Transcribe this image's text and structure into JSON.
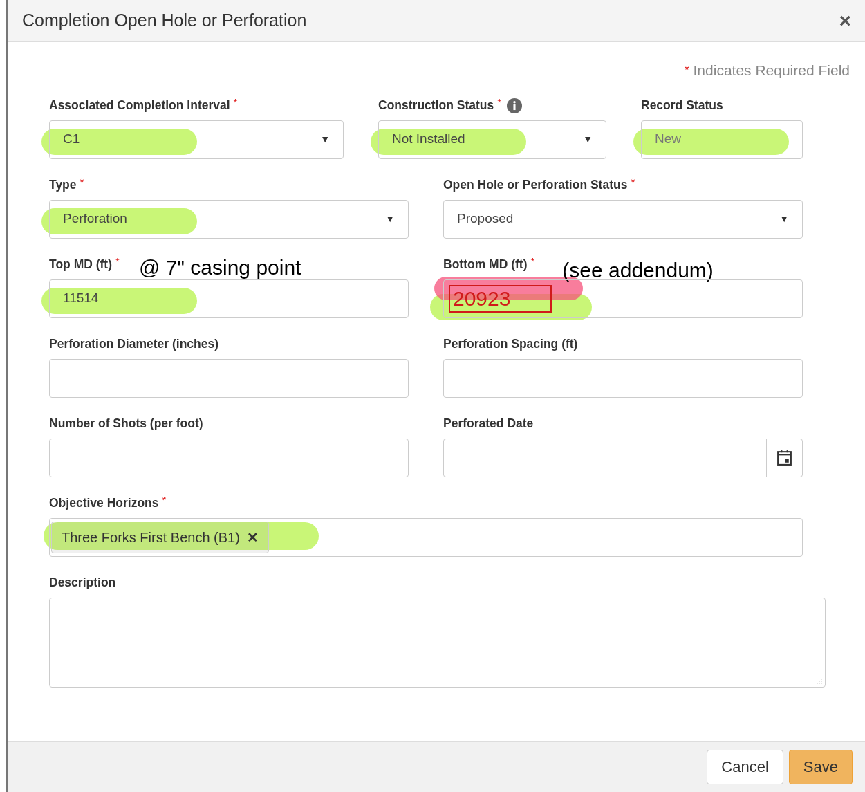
{
  "dialog": {
    "title": "Completion Open Hole or Perforation",
    "close": "×"
  },
  "required_note": {
    "mark": "*",
    "text": "Indicates Required Field"
  },
  "rows": [
    {
      "fields": [
        {
          "kind": "select",
          "label": "Associated Completion Interval",
          "required": true,
          "value": "C1",
          "caret": "▼",
          "highlighted": true
        },
        {
          "kind": "select",
          "label": "Construction Status",
          "required": true,
          "info": true,
          "value": "Not Installed",
          "caret": "▼",
          "highlighted": true
        },
        {
          "kind": "readonly",
          "label": "Record Status",
          "required": false,
          "value": "New",
          "highlighted": true
        }
      ]
    },
    {
      "fields": [
        {
          "kind": "select",
          "label": "Type",
          "required": true,
          "value": "Perforation",
          "caret": "▼",
          "highlighted": true
        },
        {
          "kind": "select",
          "label": "Open Hole or Perforation Status",
          "required": true,
          "value": "Proposed",
          "caret": "▼",
          "highlighted": false
        }
      ]
    },
    {
      "fields": [
        {
          "kind": "input",
          "label": "Top MD (ft)",
          "required": true,
          "note": "@ 7\" casing point",
          "value": "11514",
          "highlighted": true
        },
        {
          "kind": "input",
          "label": "Bottom MD (ft)",
          "required": true,
          "note": "(see addendum)",
          "value": "20923",
          "highlighted": true,
          "flagged": true
        }
      ]
    },
    {
      "fields": [
        {
          "kind": "input",
          "label": "Perforation Diameter (inches)",
          "required": false,
          "highlighted": false
        },
        {
          "kind": "input",
          "label": "Perforation Spacing (ft)",
          "required": false,
          "highlighted": false
        }
      ]
    },
    {
      "fields": [
        {
          "kind": "input",
          "label": "Number of Shots (per foot)",
          "required": false,
          "highlighted": false
        },
        {
          "kind": "date",
          "label": "Perforated Date",
          "required": false,
          "highlighted": false
        }
      ]
    },
    {
      "fields": [
        {
          "kind": "tags",
          "label": "Objective Horizons",
          "required": true,
          "tags": [
            {
              "text": "Three Forks First Bench (B1)",
              "remove": "✕"
            }
          ],
          "highlighted": true
        }
      ]
    },
    {
      "fields": [
        {
          "kind": "textarea",
          "label": "Description",
          "required": false,
          "highlighted": false
        }
      ]
    }
  ],
  "buttons": [
    {
      "label": "Cancel",
      "kind": "default"
    },
    {
      "label": "Save",
      "kind": "primary"
    }
  ]
}
